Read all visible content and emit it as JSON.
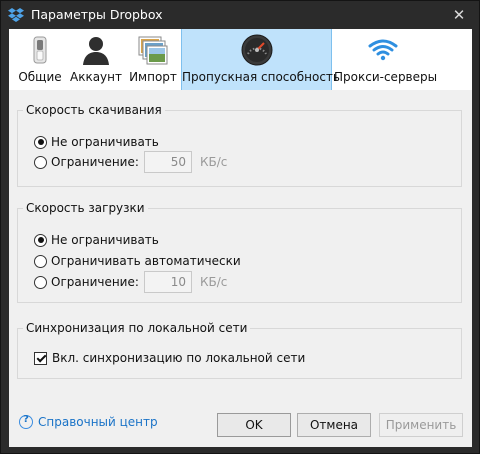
{
  "window": {
    "title": "Параметры Dropbox",
    "close_glyph": "✕"
  },
  "tabs": [
    {
      "label": "Общие",
      "icon": "switch-icon"
    },
    {
      "label": "Аккаунт",
      "icon": "person-icon"
    },
    {
      "label": "Импорт",
      "icon": "photos-icon"
    },
    {
      "label": "Пропускная способность",
      "icon": "speedometer-icon",
      "active": true
    },
    {
      "label": "Прокси-серверы",
      "icon": "wifi-icon"
    }
  ],
  "download": {
    "title": "Скорость скачивания",
    "no_limit": "Не ограничивать",
    "limit": "Ограничение:",
    "value": "50",
    "unit": "КБ/с",
    "selected": "no_limit"
  },
  "upload": {
    "title": "Скорость загрузки",
    "no_limit": "Не ограничивать",
    "auto_limit": "Ограничивать автоматически",
    "limit": "Ограничение:",
    "value": "10",
    "unit": "КБ/с",
    "selected": "no_limit"
  },
  "lan": {
    "title": "Синхронизация по локальной сети",
    "checkbox_label": "Вкл. синхронизацию по локальной сети",
    "checked": true
  },
  "footer": {
    "help_label": "Справочный центр",
    "ok_label": "OK",
    "cancel_label": "Отмена",
    "apply_label": "Применить"
  },
  "colors": {
    "active_tab": "#bfe2fb",
    "link": "#1a73c7",
    "title_bar": "#2b2b2b"
  }
}
